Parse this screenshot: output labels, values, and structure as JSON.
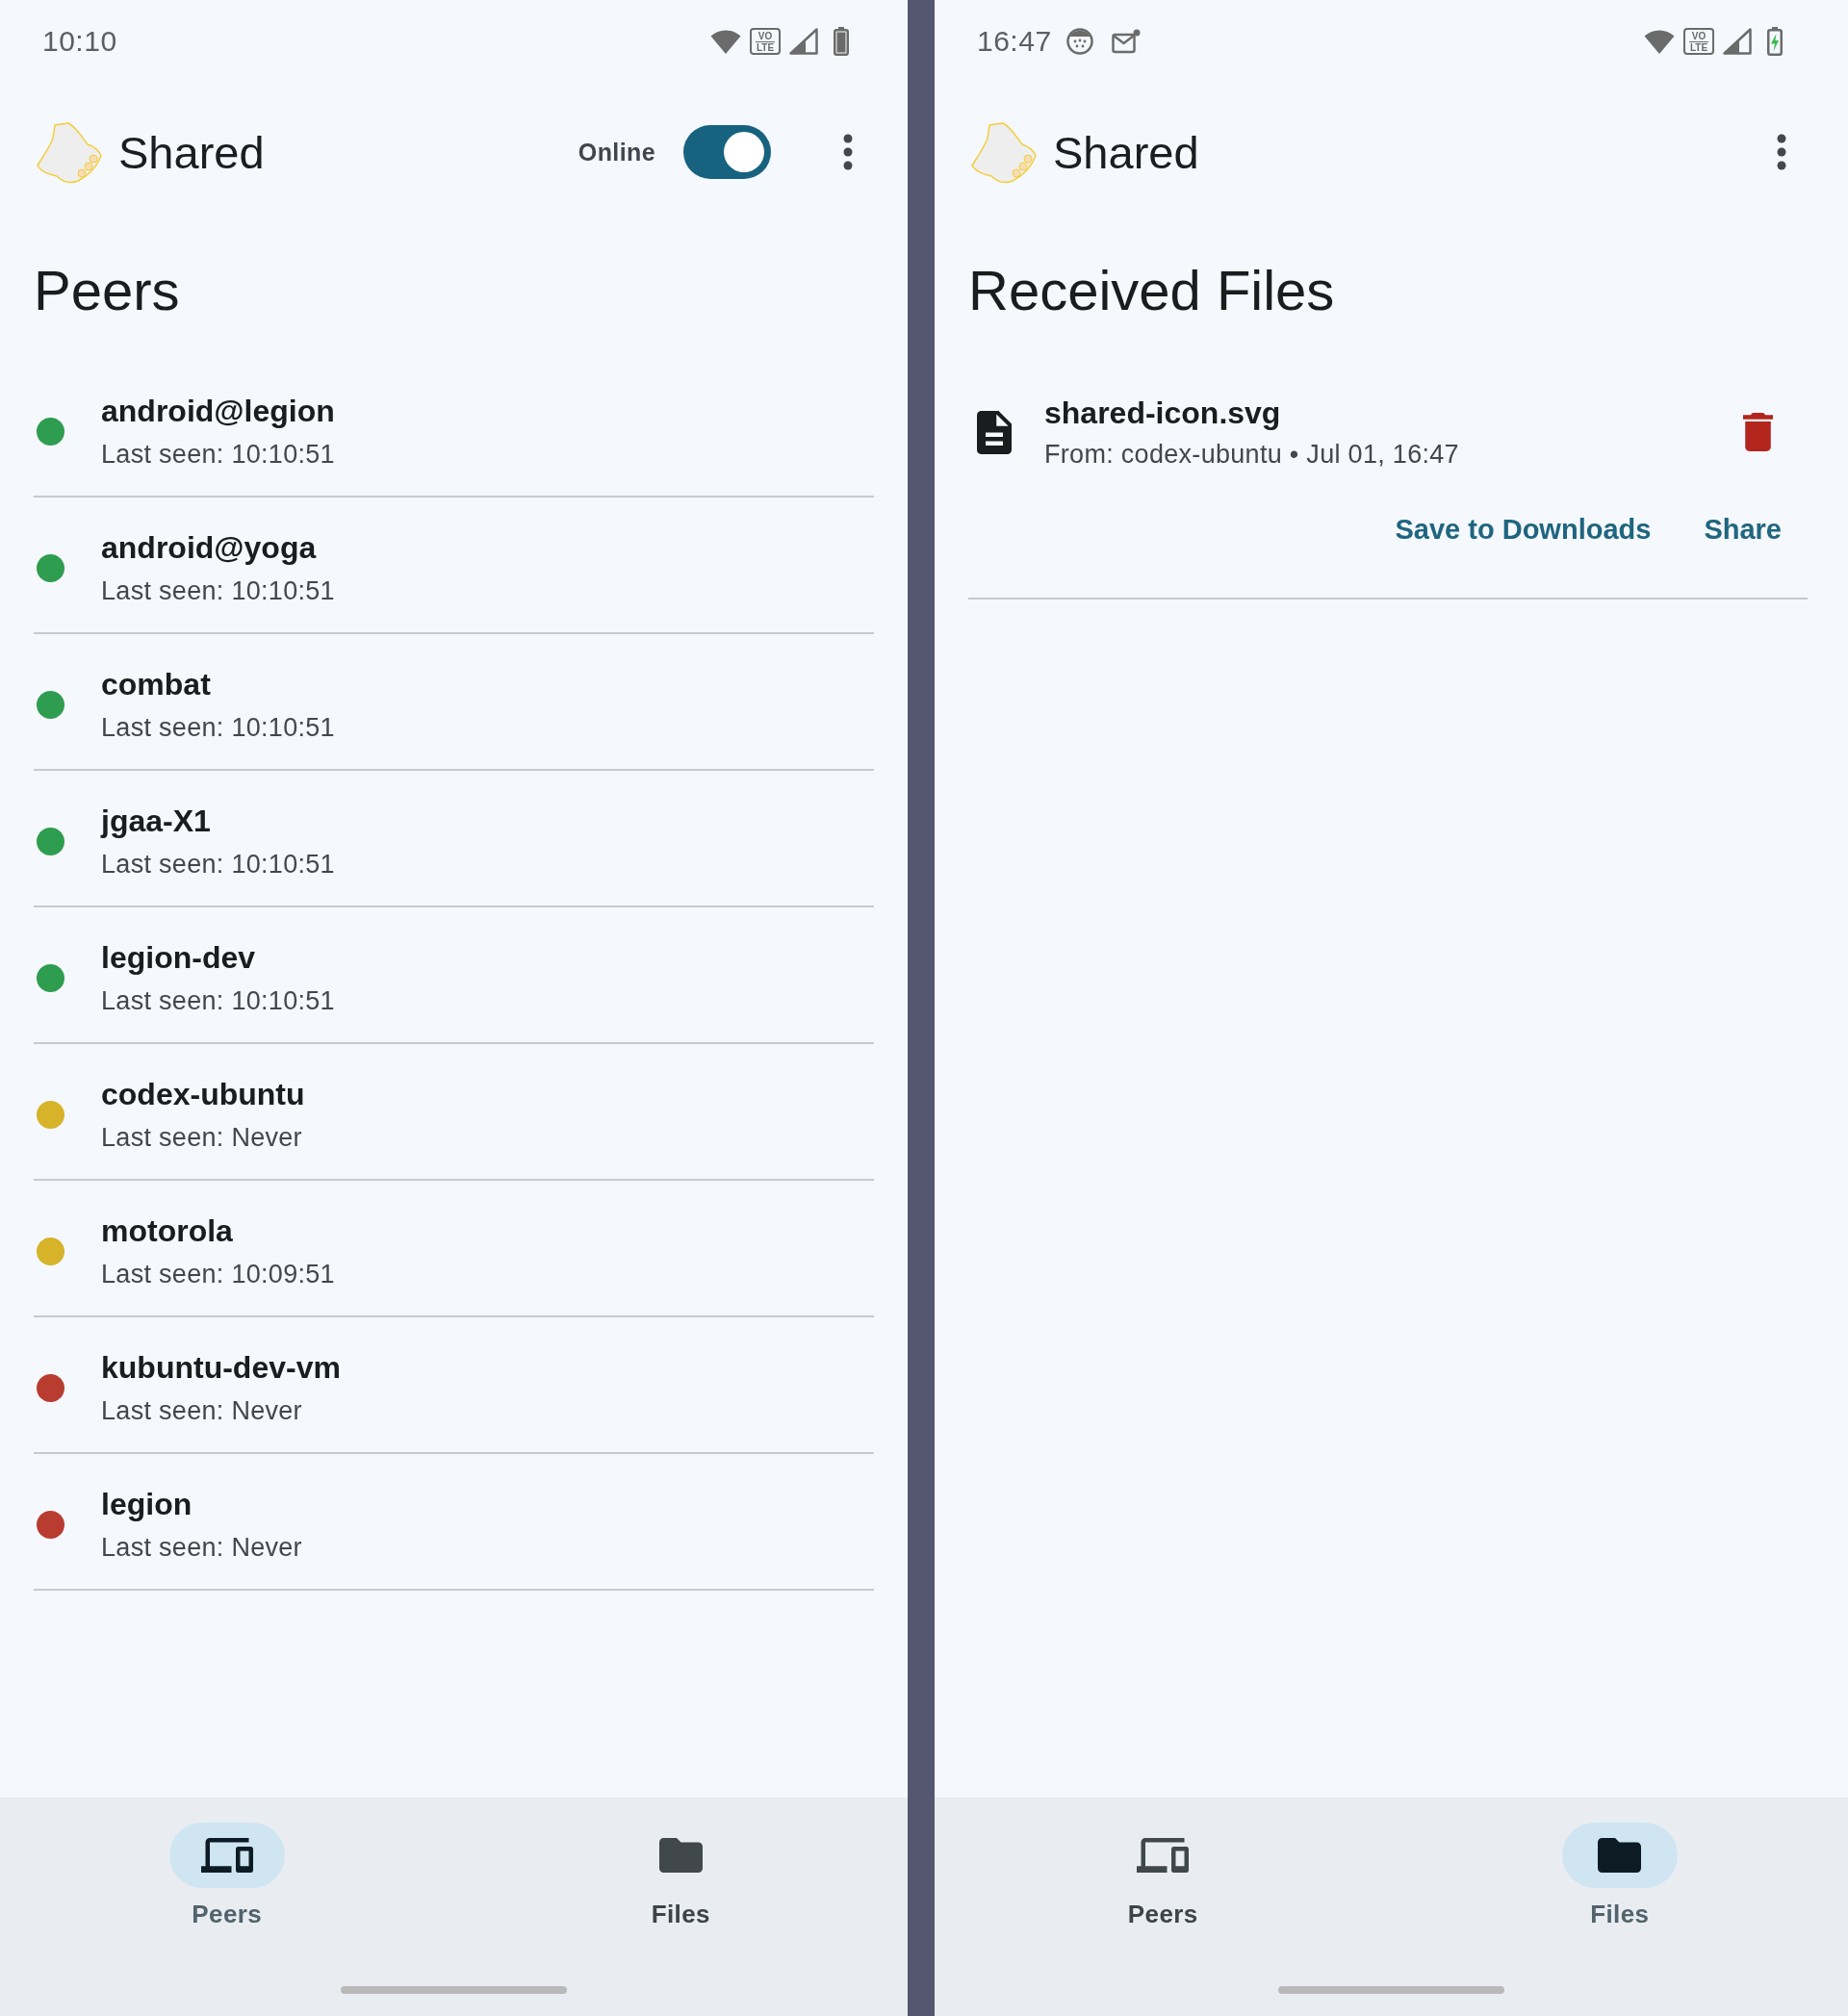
{
  "screens": [
    {
      "status_bar": {
        "time": "10:10",
        "network_badge": [
          "VO",
          "LTE"
        ],
        "charging": false
      },
      "app_bar": {
        "title": "Shared",
        "online_toggle": {
          "label": "Online",
          "on": true
        }
      },
      "page_title": "Peers",
      "peers": [
        {
          "name": "android@legion",
          "last_seen": "Last seen: 10:10:51",
          "color": "#2f9d4f"
        },
        {
          "name": "android@yoga",
          "last_seen": "Last seen: 10:10:51",
          "color": "#2f9d4f"
        },
        {
          "name": "combat",
          "last_seen": "Last seen: 10:10:51",
          "color": "#2f9d4f"
        },
        {
          "name": "jgaa-X1",
          "last_seen": "Last seen: 10:10:51",
          "color": "#2f9d4f"
        },
        {
          "name": "legion-dev",
          "last_seen": "Last seen: 10:10:51",
          "color": "#2f9d4f"
        },
        {
          "name": "codex-ubuntu",
          "last_seen": "Last seen: Never",
          "color": "#d6b328"
        },
        {
          "name": "motorola",
          "last_seen": "Last seen: 10:09:51",
          "color": "#d6b328"
        },
        {
          "name": "kubuntu-dev-vm",
          "last_seen": "Last seen: Never",
          "color": "#b93c30"
        },
        {
          "name": "legion",
          "last_seen": "Last seen: Never",
          "color": "#b93c30"
        }
      ],
      "bottom_nav": [
        {
          "label": "Peers",
          "selected": true
        },
        {
          "label": "Files",
          "selected": false
        }
      ]
    },
    {
      "status_bar": {
        "time": "16:47",
        "notifications": [
          {
            "kind": "dotted-circle"
          },
          {
            "kind": "mail"
          }
        ],
        "network_badge": [
          "VO",
          "LTE"
        ],
        "charging": true
      },
      "app_bar": {
        "title": "Shared"
      },
      "page_title": "Received Files",
      "files": [
        {
          "name": "shared-icon.svg",
          "details": "From: codex-ubuntu • Jul 01, 16:47",
          "actions": [
            "Save to Downloads",
            "Share"
          ]
        }
      ],
      "bottom_nav": [
        {
          "label": "Peers",
          "selected": false
        },
        {
          "label": "Files",
          "selected": true
        }
      ]
    }
  ]
}
